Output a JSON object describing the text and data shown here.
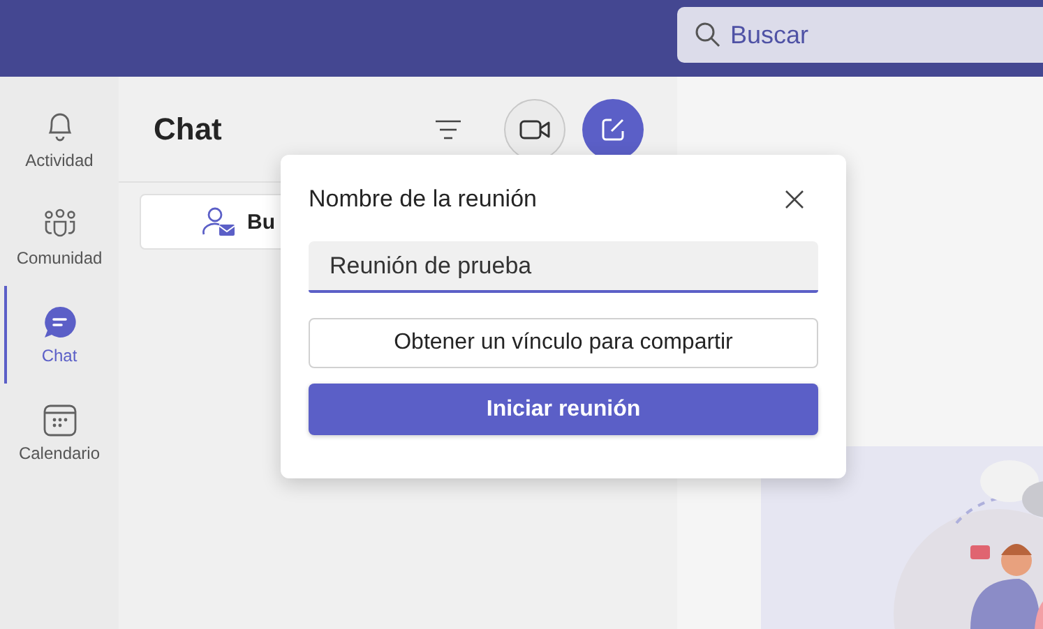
{
  "top_bar": {
    "search": {
      "placeholder": "Buscar"
    }
  },
  "rail": {
    "items": [
      {
        "label": "Actividad",
        "selected": false
      },
      {
        "label": "Comunidad",
        "selected": false
      },
      {
        "label": "Chat",
        "selected": true
      },
      {
        "label": "Calendario",
        "selected": false
      }
    ]
  },
  "chat_panel": {
    "title": "Chat",
    "new_chat_button": {
      "label": "Bu"
    }
  },
  "dialog": {
    "title": "Nombre de la reunión",
    "name_field": {
      "value": "Reunión de prueba"
    },
    "buttons": [
      {
        "label": "Obtener un vínculo para compartir",
        "kind": "secondary"
      },
      {
        "label": "Iniciar reunión",
        "kind": "primary"
      }
    ]
  }
}
